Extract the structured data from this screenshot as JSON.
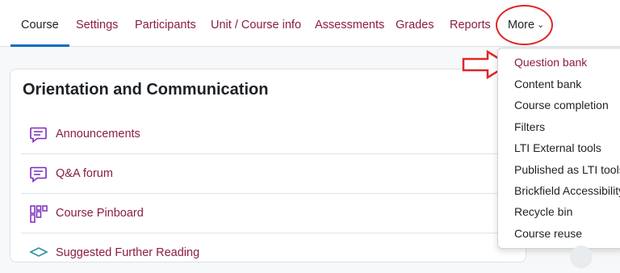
{
  "nav": {
    "tabs": [
      {
        "label": "Course"
      },
      {
        "label": "Settings"
      },
      {
        "label": "Participants"
      },
      {
        "label": "Unit / Course info"
      },
      {
        "label": "Assessments"
      },
      {
        "label": "Grades"
      },
      {
        "label": "Reports"
      },
      {
        "label": "More"
      }
    ],
    "more_chevron": "⌄"
  },
  "section": {
    "title": "Orientation and Communication",
    "activities": [
      {
        "name": "Announcements",
        "icon": "forum-icon"
      },
      {
        "name": "Q&A forum",
        "icon": "forum-icon"
      },
      {
        "name": "Course Pinboard",
        "icon": "pinboard-icon"
      },
      {
        "name": "Suggested Further Reading",
        "icon": "book-icon"
      }
    ]
  },
  "more_menu": {
    "items": [
      {
        "label": "Question bank"
      },
      {
        "label": "Content bank"
      },
      {
        "label": "Course completion"
      },
      {
        "label": "Filters"
      },
      {
        "label": "LTI External tools"
      },
      {
        "label": "Published as LTI tools"
      },
      {
        "label": "Brickfield Accessibility+"
      },
      {
        "label": "Recycle bin"
      },
      {
        "label": "Course reuse"
      }
    ]
  },
  "colors": {
    "link": "#8b1e3f",
    "active_underline": "#0f6cbf",
    "icon_purple": "#7b2cbf",
    "annotation_red": "#e12626"
  }
}
